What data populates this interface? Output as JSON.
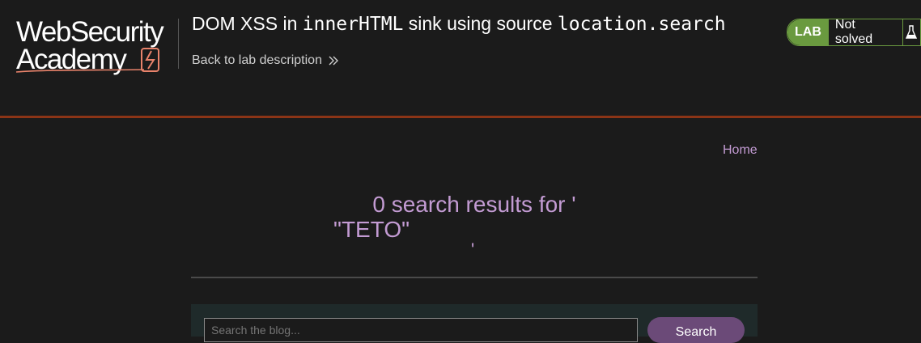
{
  "header": {
    "logo": {
      "line1": "WebSecurity",
      "line2": "Academy"
    },
    "lab_title": {
      "prefix": "DOM XSS in ",
      "code1": "innerHTML",
      "middle": " sink using source ",
      "code2": "location.search"
    },
    "back_link": "Back to lab description",
    "status": {
      "badge": "LAB",
      "text": "Not solved",
      "icon": "flask-icon"
    }
  },
  "nav": {
    "home": "Home"
  },
  "results": {
    "line1": "0 search results for '",
    "term": "\"TETO\"",
    "close_quote": "'"
  },
  "search": {
    "placeholder": "Search the blog...",
    "button": "Search"
  },
  "colors": {
    "background": "#1b1b1b",
    "accent_rule": "#8b3416",
    "link_purple": "#c39bd3",
    "lab_green": "#6a9a3f",
    "button_purple": "#6b4a78"
  }
}
